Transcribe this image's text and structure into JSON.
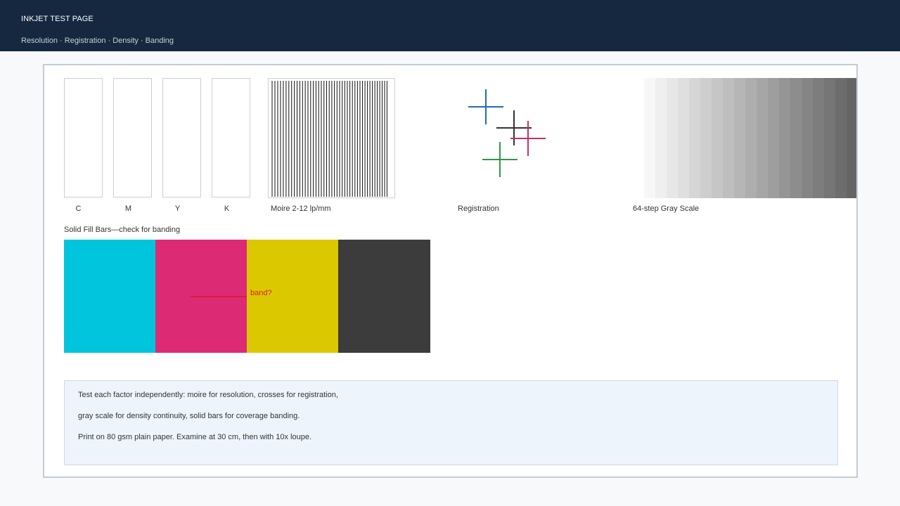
{
  "header": {
    "title": "INKJET TEST PAGE",
    "subtitle": "Resolution · Registration · Density · Banding"
  },
  "colors": {
    "cyan": "#00c5dc",
    "magenta": "#dd2a75",
    "yellow": "#dcc800",
    "black": "#3c3c3c",
    "reg_blue": "#1f6db3",
    "reg_black": "#333333",
    "reg_magenta": "#c0306e",
    "reg_green": "#2e9a44",
    "band_marker": "#d9202e"
  },
  "swatches": [
    {
      "label": "C",
      "color": "#00c5dc"
    },
    {
      "label": "M",
      "color": "#dd2a75"
    },
    {
      "label": "Y",
      "color": "#dcc800"
    },
    {
      "label": "K",
      "color": "#3c3c3c"
    }
  ],
  "moire": {
    "label": "Moire 2-12 lp/mm",
    "line_count": 45
  },
  "registration": {
    "label": "Registration",
    "crosses": [
      "blue",
      "black",
      "magenta",
      "green"
    ]
  },
  "grayscale": {
    "label": "64-step Gray Scale",
    "steps": 64
  },
  "solid_fill": {
    "label": "Solid Fill Bars—check for banding",
    "bars": [
      "cyan",
      "magenta",
      "yellow",
      "black"
    ],
    "band_marker_label": "band?"
  },
  "notes": {
    "line1": "Test each factor independently: moire for resolution, crosses for registration,",
    "line2": "gray scale for density continuity, solid bars for coverage banding.",
    "line3": "Print on 80 gsm plain paper. Examine at 30 cm, then with 10x loupe."
  }
}
